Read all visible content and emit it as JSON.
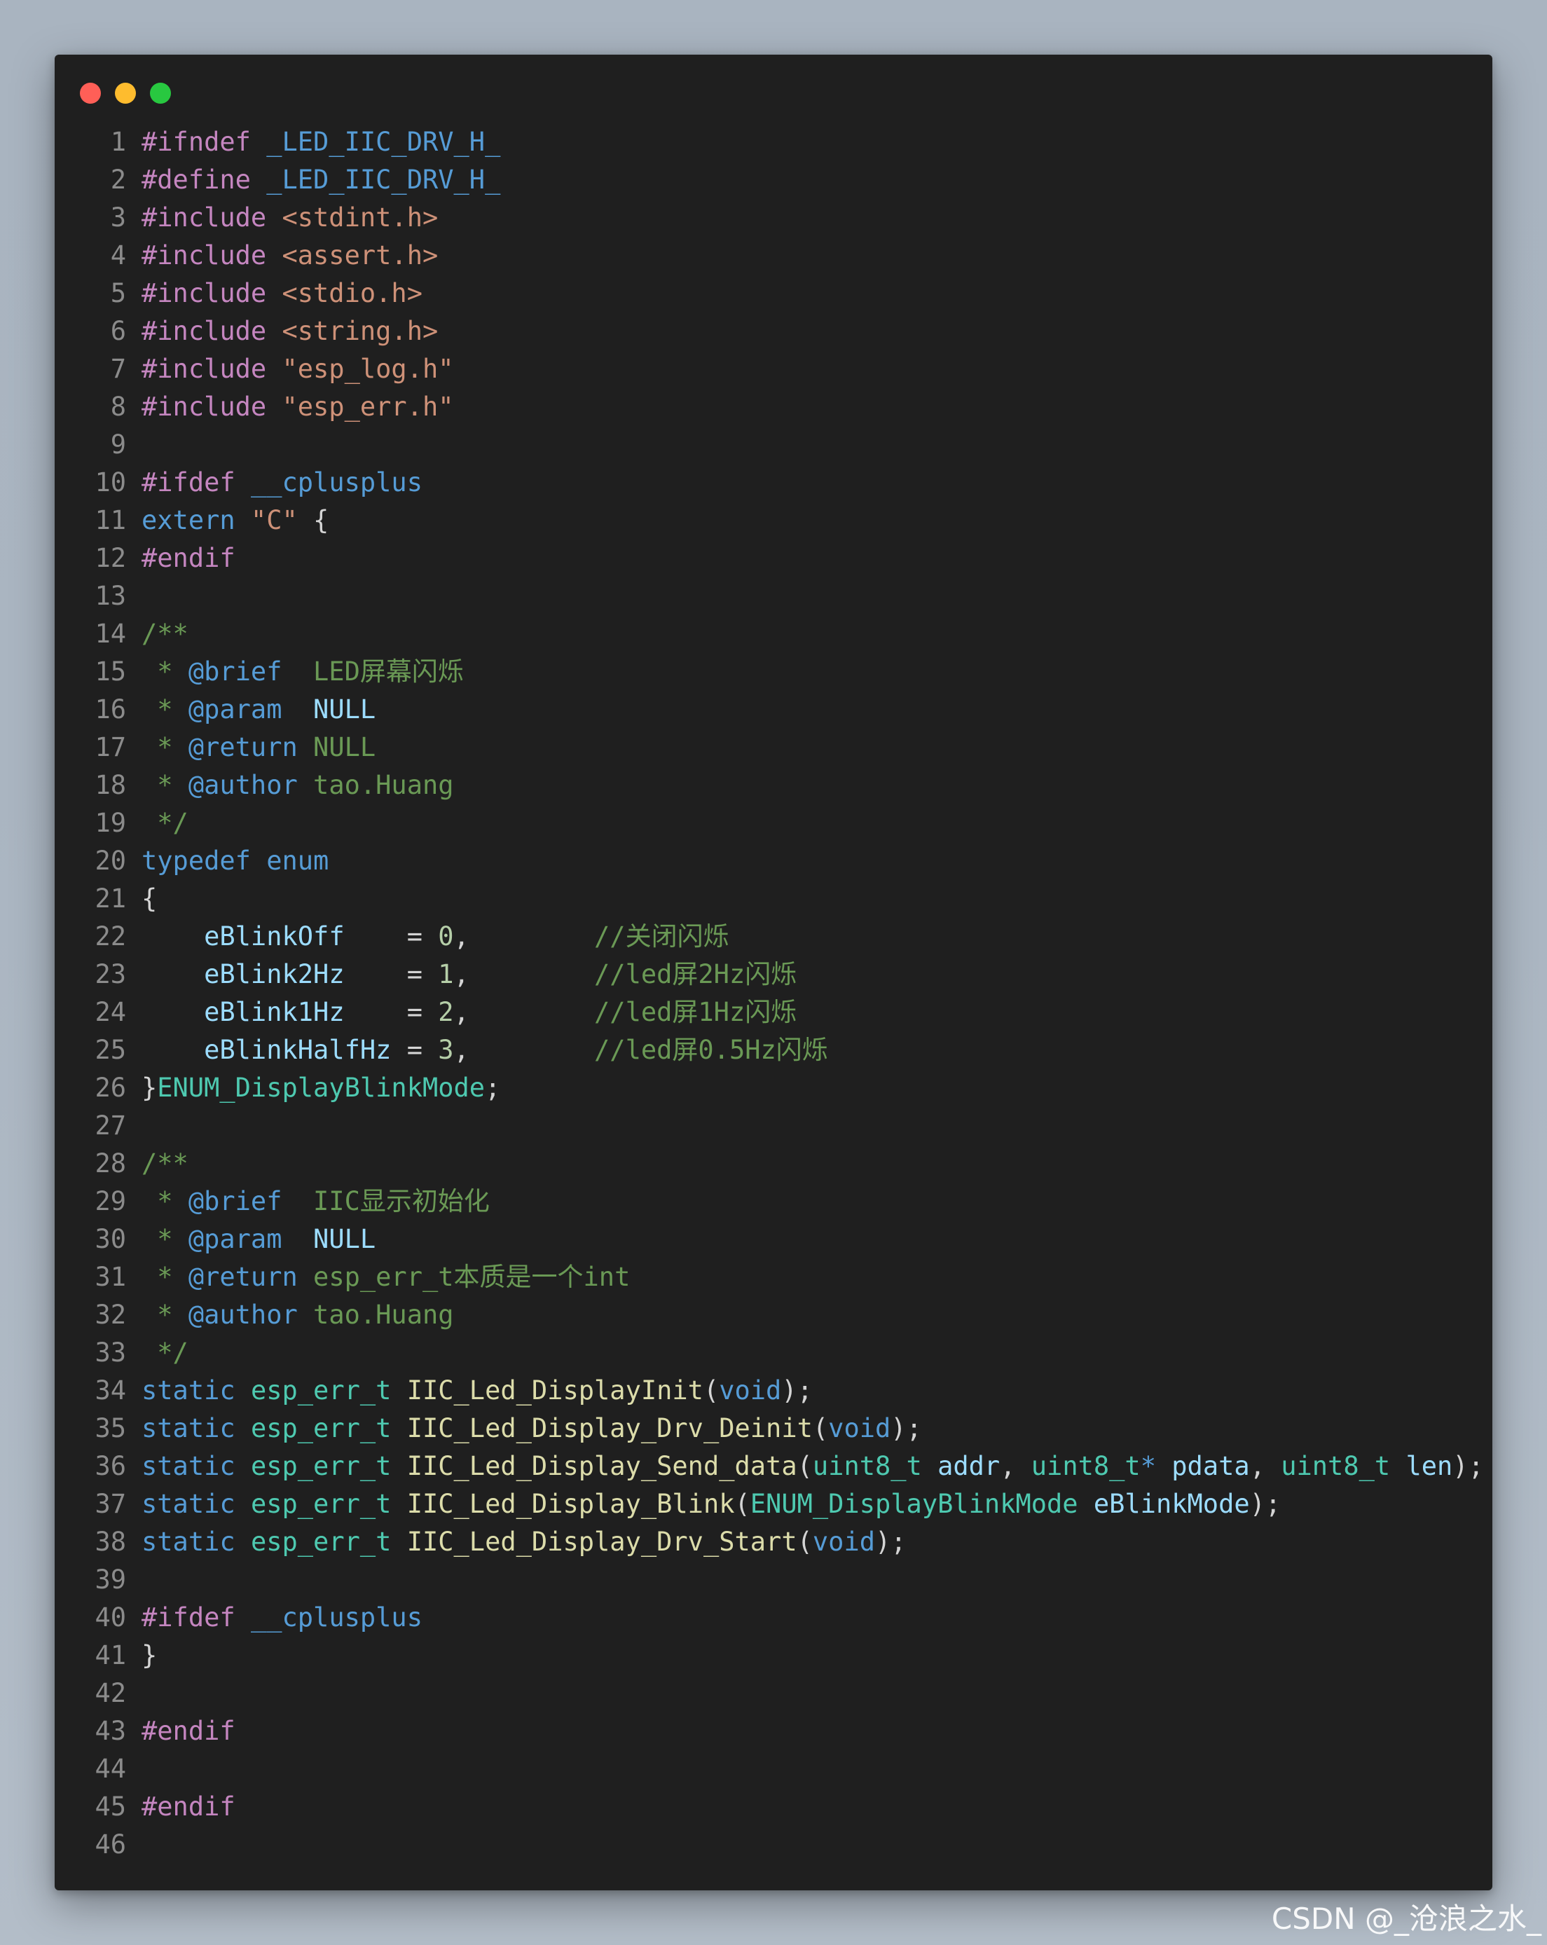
{
  "window": {
    "controls": [
      {
        "name": "close",
        "color": "#ff5f57"
      },
      {
        "name": "minimize",
        "color": "#febc2e"
      },
      {
        "name": "maximize",
        "color": "#28c840"
      }
    ]
  },
  "code": {
    "lines": [
      {
        "n": "1",
        "t": [
          [
            "pp",
            "#ifndef "
          ],
          [
            "mac",
            "_LED_IIC_DRV_H_"
          ]
        ]
      },
      {
        "n": "2",
        "t": [
          [
            "pp",
            "#define "
          ],
          [
            "mac",
            "_LED_IIC_DRV_H_"
          ]
        ]
      },
      {
        "n": "3",
        "t": [
          [
            "pp",
            "#include "
          ],
          [
            "str",
            "<stdint.h>"
          ]
        ]
      },
      {
        "n": "4",
        "t": [
          [
            "pp",
            "#include "
          ],
          [
            "str",
            "<assert.h>"
          ]
        ]
      },
      {
        "n": "5",
        "t": [
          [
            "pp",
            "#include "
          ],
          [
            "str",
            "<stdio.h>"
          ]
        ]
      },
      {
        "n": "6",
        "t": [
          [
            "pp",
            "#include "
          ],
          [
            "str",
            "<string.h>"
          ]
        ]
      },
      {
        "n": "7",
        "t": [
          [
            "pp",
            "#include "
          ],
          [
            "str",
            "\"esp_log.h\""
          ]
        ]
      },
      {
        "n": "8",
        "t": [
          [
            "pp",
            "#include "
          ],
          [
            "str",
            "\"esp_err.h\""
          ]
        ]
      },
      {
        "n": "9",
        "t": []
      },
      {
        "n": "10",
        "t": [
          [
            "pp",
            "#ifdef "
          ],
          [
            "mac",
            "__cplusplus"
          ]
        ]
      },
      {
        "n": "11",
        "t": [
          [
            "kw",
            "extern "
          ],
          [
            "str",
            "\"C\""
          ],
          [
            "pl",
            " {"
          ]
        ]
      },
      {
        "n": "12",
        "t": [
          [
            "pp",
            "#endif"
          ]
        ]
      },
      {
        "n": "13",
        "t": []
      },
      {
        "n": "14",
        "t": [
          [
            "cm",
            "/**"
          ]
        ]
      },
      {
        "n": "15",
        "t": [
          [
            "cm",
            " * "
          ],
          [
            "tag",
            "@brief"
          ],
          [
            "cm",
            "  LED屏幕闪烁"
          ]
        ]
      },
      {
        "n": "16",
        "t": [
          [
            "cm",
            " * "
          ],
          [
            "tag",
            "@param"
          ],
          [
            "cm",
            "  "
          ],
          [
            "cmv",
            "NULL"
          ]
        ]
      },
      {
        "n": "17",
        "t": [
          [
            "cm",
            " * "
          ],
          [
            "tag",
            "@return"
          ],
          [
            "cm",
            " NULL"
          ]
        ]
      },
      {
        "n": "18",
        "t": [
          [
            "cm",
            " * "
          ],
          [
            "tag",
            "@author"
          ],
          [
            "cm",
            " tao.Huang"
          ]
        ]
      },
      {
        "n": "19",
        "t": [
          [
            "cm",
            " */"
          ]
        ]
      },
      {
        "n": "20",
        "t": [
          [
            "kw",
            "typedef "
          ],
          [
            "kw",
            "enum"
          ]
        ]
      },
      {
        "n": "21",
        "t": [
          [
            "pl",
            "{"
          ]
        ]
      },
      {
        "n": "22",
        "t": [
          [
            "pl",
            "    "
          ],
          [
            "var",
            "eBlinkOff"
          ],
          [
            "pl",
            "    = "
          ],
          [
            "num",
            "0"
          ],
          [
            "pl",
            ",        "
          ],
          [
            "cm",
            "//关闭闪烁"
          ]
        ]
      },
      {
        "n": "23",
        "t": [
          [
            "pl",
            "    "
          ],
          [
            "var",
            "eBlink2Hz"
          ],
          [
            "pl",
            "    = "
          ],
          [
            "num",
            "1"
          ],
          [
            "pl",
            ",        "
          ],
          [
            "cm",
            "//led屏2Hz闪烁"
          ]
        ]
      },
      {
        "n": "24",
        "t": [
          [
            "pl",
            "    "
          ],
          [
            "var",
            "eBlink1Hz"
          ],
          [
            "pl",
            "    = "
          ],
          [
            "num",
            "2"
          ],
          [
            "pl",
            ",        "
          ],
          [
            "cm",
            "//led屏1Hz闪烁"
          ]
        ]
      },
      {
        "n": "25",
        "t": [
          [
            "pl",
            "    "
          ],
          [
            "var",
            "eBlinkHalfHz"
          ],
          [
            "pl",
            " = "
          ],
          [
            "num",
            "3"
          ],
          [
            "pl",
            ",        "
          ],
          [
            "cm",
            "//led屏0.5Hz闪烁"
          ]
        ]
      },
      {
        "n": "26",
        "t": [
          [
            "pl",
            "}"
          ],
          [
            "ty",
            "ENUM_DisplayBlinkMode"
          ],
          [
            "pl",
            ";"
          ]
        ]
      },
      {
        "n": "27",
        "t": []
      },
      {
        "n": "28",
        "t": [
          [
            "cm",
            "/**"
          ]
        ]
      },
      {
        "n": "29",
        "t": [
          [
            "cm",
            " * "
          ],
          [
            "tag",
            "@brief"
          ],
          [
            "cm",
            "  IIC显示初始化"
          ]
        ]
      },
      {
        "n": "30",
        "t": [
          [
            "cm",
            " * "
          ],
          [
            "tag",
            "@param"
          ],
          [
            "cm",
            "  "
          ],
          [
            "cmv",
            "NULL"
          ]
        ]
      },
      {
        "n": "31",
        "t": [
          [
            "cm",
            " * "
          ],
          [
            "tag",
            "@return"
          ],
          [
            "cm",
            " esp_err_t本质是一个int"
          ]
        ]
      },
      {
        "n": "32",
        "t": [
          [
            "cm",
            " * "
          ],
          [
            "tag",
            "@author"
          ],
          [
            "cm",
            " tao.Huang"
          ]
        ]
      },
      {
        "n": "33",
        "t": [
          [
            "cm",
            " */"
          ]
        ]
      },
      {
        "n": "34",
        "t": [
          [
            "kw",
            "static "
          ],
          [
            "ty",
            "esp_err_t "
          ],
          [
            "fn",
            "IIC_Led_DisplayInit"
          ],
          [
            "pl",
            "("
          ],
          [
            "kw",
            "void"
          ],
          [
            "pl",
            ");"
          ]
        ]
      },
      {
        "n": "35",
        "t": [
          [
            "kw",
            "static "
          ],
          [
            "ty",
            "esp_err_t "
          ],
          [
            "fn",
            "IIC_Led_Display_Drv_Deinit"
          ],
          [
            "pl",
            "("
          ],
          [
            "kw",
            "void"
          ],
          [
            "pl",
            ");"
          ]
        ]
      },
      {
        "n": "36",
        "t": [
          [
            "kw",
            "static "
          ],
          [
            "ty",
            "esp_err_t "
          ],
          [
            "fn",
            "IIC_Led_Display_Send_data"
          ],
          [
            "pl",
            "("
          ],
          [
            "ty",
            "uint8_t "
          ],
          [
            "var",
            "addr"
          ],
          [
            "pl",
            ", "
          ],
          [
            "ty",
            "uint8_t"
          ],
          [
            "kw",
            "* "
          ],
          [
            "var",
            "pdata"
          ],
          [
            "pl",
            ", "
          ],
          [
            "ty",
            "uint8_t "
          ],
          [
            "var",
            "len"
          ],
          [
            "pl",
            ");"
          ]
        ]
      },
      {
        "n": "37",
        "t": [
          [
            "kw",
            "static "
          ],
          [
            "ty",
            "esp_err_t "
          ],
          [
            "fn",
            "IIC_Led_Display_Blink"
          ],
          [
            "pl",
            "("
          ],
          [
            "ty",
            "ENUM_DisplayBlinkMode "
          ],
          [
            "var",
            "eBlinkMode"
          ],
          [
            "pl",
            ");"
          ]
        ]
      },
      {
        "n": "38",
        "t": [
          [
            "kw",
            "static "
          ],
          [
            "ty",
            "esp_err_t "
          ],
          [
            "fn",
            "IIC_Led_Display_Drv_Start"
          ],
          [
            "pl",
            "("
          ],
          [
            "kw",
            "void"
          ],
          [
            "pl",
            ");"
          ]
        ]
      },
      {
        "n": "39",
        "t": []
      },
      {
        "n": "40",
        "t": [
          [
            "pp",
            "#ifdef "
          ],
          [
            "mac",
            "__cplusplus"
          ]
        ]
      },
      {
        "n": "41",
        "t": [
          [
            "pl",
            "}"
          ]
        ]
      },
      {
        "n": "42",
        "t": []
      },
      {
        "n": "43",
        "t": [
          [
            "pp",
            "#endif"
          ]
        ]
      },
      {
        "n": "44",
        "t": []
      },
      {
        "n": "45",
        "t": [
          [
            "pp",
            "#endif"
          ]
        ]
      },
      {
        "n": "46",
        "t": []
      }
    ]
  },
  "watermark": "CSDN @_沧浪之水_"
}
